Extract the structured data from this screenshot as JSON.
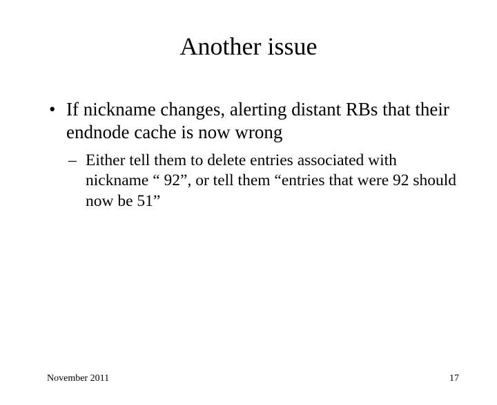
{
  "title": "Another issue",
  "bullets": {
    "l1": "If nickname changes, alerting distant RBs that their endnode cache is now wrong",
    "l2": "Either tell them to delete entries associated with nickname “ 92”, or tell them “entries that were 92 should now be 51”"
  },
  "footer": {
    "left": "November 2011",
    "right": "17"
  }
}
